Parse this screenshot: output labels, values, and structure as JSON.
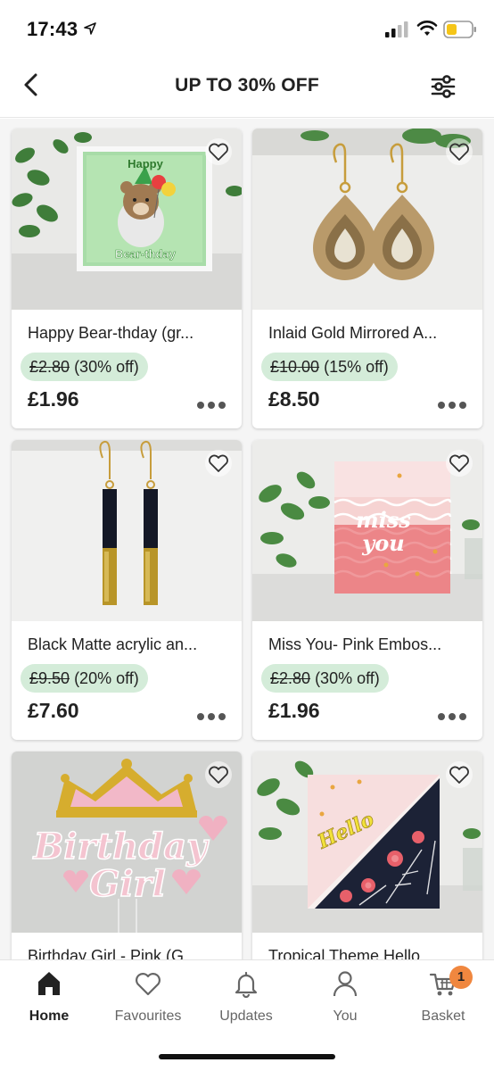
{
  "status_bar": {
    "time": "17:43"
  },
  "header": {
    "title": "UP TO 30% OFF",
    "back_icon": "chevron-left-icon",
    "filter_icon": "sliders-icon"
  },
  "products": [
    {
      "title": "Happy Bear-thday (gr...",
      "old_price": "£2.80",
      "discount": "(30% off)",
      "price": "£1.96",
      "card_text_top": "Happy",
      "card_text_bottom": "Bear-thday"
    },
    {
      "title": "Inlaid Gold Mirrored A...",
      "old_price": "£10.00",
      "discount": "(15% off)",
      "price": "£8.50"
    },
    {
      "title": "Black Matte acrylic an...",
      "old_price": "£9.50",
      "discount": "(20% off)",
      "price": "£7.60"
    },
    {
      "title": "Miss You- Pink Embos...",
      "old_price": "£2.80",
      "discount": "(30% off)",
      "price": "£1.96",
      "card_text_top": "miss",
      "card_text_bottom": "you"
    },
    {
      "title": "Birthday Girl - Pink (G...",
      "card_text_top": "Birthday",
      "card_text_bottom": "Girl"
    },
    {
      "title": "Tropical Theme Hello...",
      "card_text_top": "Hello"
    }
  ],
  "tab_bar": {
    "tabs": [
      {
        "label": "Home",
        "icon": "home-icon",
        "active": true
      },
      {
        "label": "Favourites",
        "icon": "heart-icon",
        "active": false
      },
      {
        "label": "Updates",
        "icon": "bell-icon",
        "active": false
      },
      {
        "label": "You",
        "icon": "person-icon",
        "active": false
      },
      {
        "label": "Basket",
        "icon": "cart-icon",
        "active": false,
        "badge": "1"
      }
    ]
  },
  "colors": {
    "discount_pill": "#d4ecd9",
    "badge": "#f0873f",
    "text": "#222222"
  }
}
